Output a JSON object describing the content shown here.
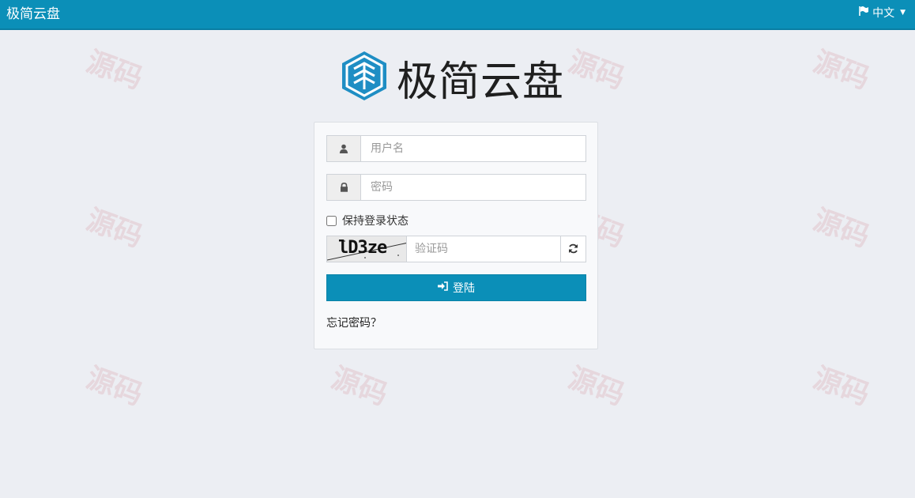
{
  "header": {
    "brand": "极简云盘",
    "language_label": "中文"
  },
  "logo": {
    "title": "极简云盘",
    "icon": "cube-logo-icon"
  },
  "form": {
    "username_placeholder": "用户名",
    "password_placeholder": "密码",
    "remember_label": "保持登录状态",
    "captcha_text": "lD3ze",
    "captcha_placeholder": "验证码",
    "login_label": "登陆",
    "forgot_label": "忘记密码？"
  },
  "icons": {
    "flag": "flag-icon",
    "caret": "chevron-down-icon",
    "user": "user-icon",
    "lock": "lock-icon",
    "refresh": "refresh-icon",
    "signin": "sign-in-icon"
  },
  "colors": {
    "primary": "#0b8fb8",
    "background": "#eceef3",
    "logo_blue": "#1f8ec4"
  }
}
